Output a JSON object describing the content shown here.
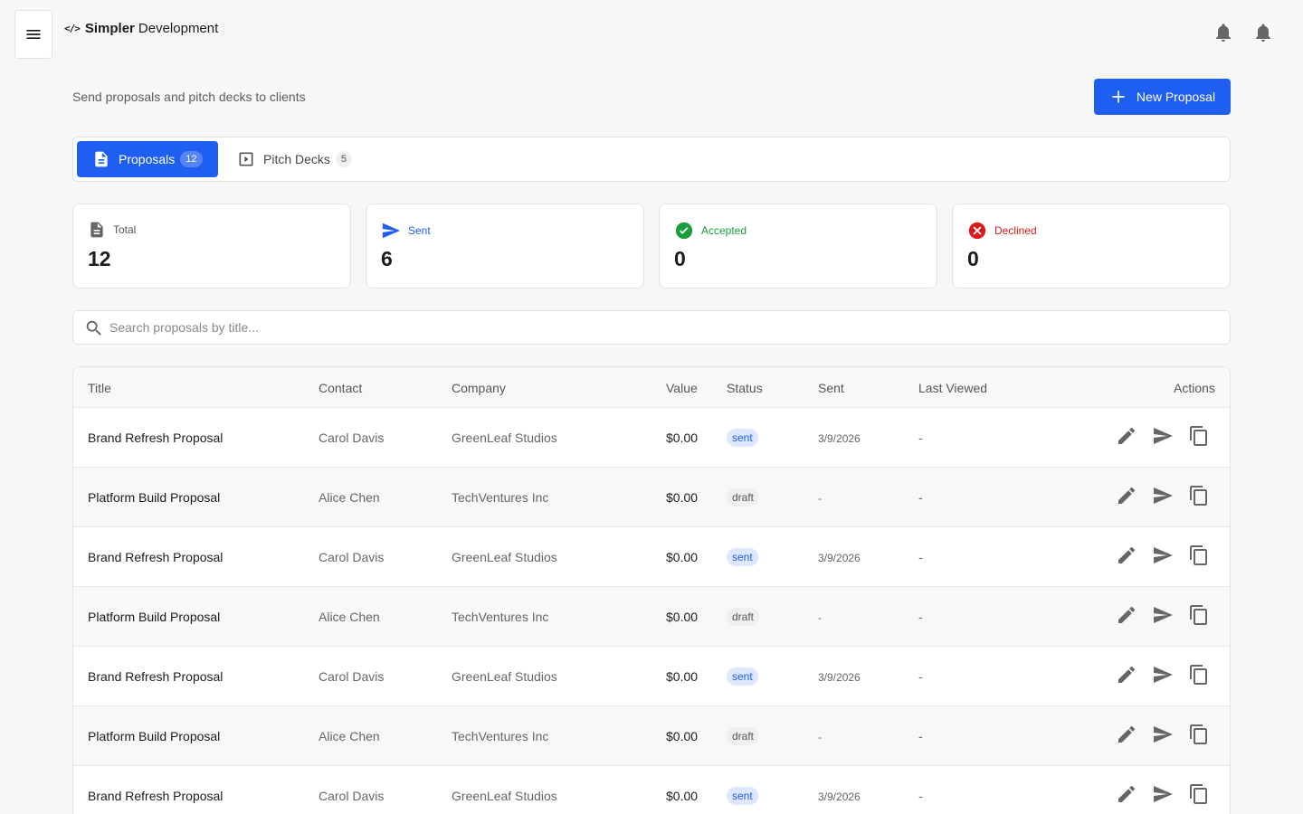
{
  "header": {
    "brand_code": "</>",
    "brand_bold": "Simpler",
    "brand_rest": "Development",
    "subtitle": "Send proposals and pitch decks to clients",
    "new_button": "New Proposal"
  },
  "tabs": [
    {
      "label": "Proposals",
      "count": "12",
      "active": true
    },
    {
      "label": "Pitch Decks",
      "count": "5",
      "active": false
    }
  ],
  "stats": [
    {
      "label": "Total",
      "value": "12",
      "color": "#444444",
      "icon": "document-icon"
    },
    {
      "label": "Sent",
      "value": "6",
      "color": "#1e5ef0",
      "icon": "send-icon"
    },
    {
      "label": "Accepted",
      "value": "0",
      "color": "#1a9e3c",
      "icon": "check-circle-icon"
    },
    {
      "label": "Declined",
      "value": "0",
      "color": "#d91b1b",
      "icon": "x-circle-icon"
    }
  ],
  "search": {
    "placeholder": "Search proposals by title..."
  },
  "table": {
    "columns": [
      "Title",
      "Contact",
      "Company",
      "Value",
      "Status",
      "Sent",
      "Last Viewed",
      "Actions"
    ],
    "rows": [
      {
        "title": "Brand Refresh Proposal",
        "contact": "Carol Davis",
        "company": "GreenLeaf Studios",
        "value": "$0.00",
        "status": "sent",
        "sent": "3/9/2026",
        "viewed": "-"
      },
      {
        "title": "Platform Build Proposal",
        "contact": "Alice Chen",
        "company": "TechVentures Inc",
        "value": "$0.00",
        "status": "draft",
        "sent": "-",
        "viewed": "-"
      },
      {
        "title": "Brand Refresh Proposal",
        "contact": "Carol Davis",
        "company": "GreenLeaf Studios",
        "value": "$0.00",
        "status": "sent",
        "sent": "3/9/2026",
        "viewed": "-"
      },
      {
        "title": "Platform Build Proposal",
        "contact": "Alice Chen",
        "company": "TechVentures Inc",
        "value": "$0.00",
        "status": "draft",
        "sent": "-",
        "viewed": "-"
      },
      {
        "title": "Brand Refresh Proposal",
        "contact": "Carol Davis",
        "company": "GreenLeaf Studios",
        "value": "$0.00",
        "status": "sent",
        "sent": "3/9/2026",
        "viewed": "-"
      },
      {
        "title": "Platform Build Proposal",
        "contact": "Alice Chen",
        "company": "TechVentures Inc",
        "value": "$0.00",
        "status": "draft",
        "sent": "-",
        "viewed": "-"
      },
      {
        "title": "Brand Refresh Proposal",
        "contact": "Carol Davis",
        "company": "GreenLeaf Studios",
        "value": "$0.00",
        "status": "sent",
        "sent": "3/9/2026",
        "viewed": "-"
      }
    ]
  },
  "icons": {
    "menu": "menu-icon",
    "bells": [
      "bell-icon",
      "bell-icon"
    ],
    "row_actions": [
      "edit-icon",
      "send-icon",
      "copy-icon"
    ]
  }
}
